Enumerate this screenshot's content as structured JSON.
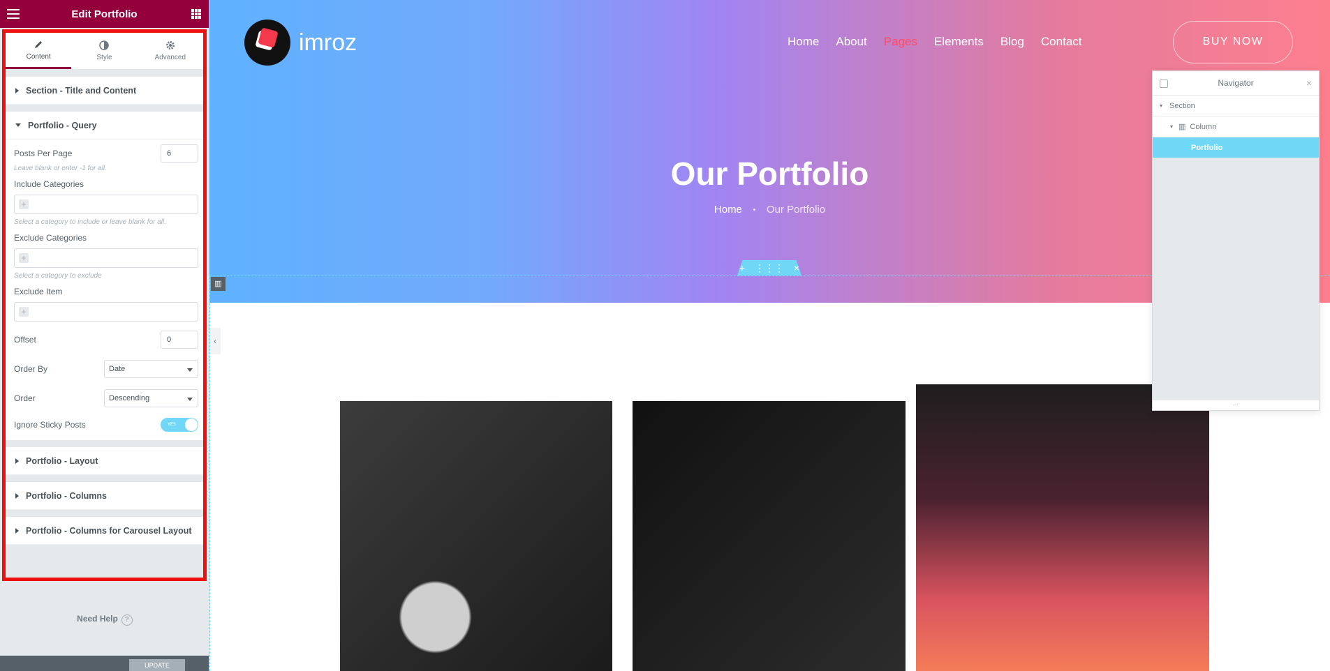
{
  "editor": {
    "title": "Edit Portfolio",
    "tabs": [
      "Content",
      "Style",
      "Advanced"
    ],
    "sections": {
      "title_content": "Section - Title and Content",
      "query": "Portfolio - Query",
      "layout": "Portfolio - Layout",
      "columns": "Portfolio - Columns",
      "carousel": "Portfolio - Columns for Carousel Layout"
    },
    "posts_per_page": {
      "label": "Posts Per Page",
      "value": "6",
      "desc": "Leave blank or enter -1 for all."
    },
    "include_categories": {
      "label": "Include Categories",
      "desc": "Select a category to include or leave blank for all."
    },
    "exclude_categories": {
      "label": "Exclude Categories",
      "desc": "Select a category to exclude"
    },
    "exclude_item": {
      "label": "Exclude Item"
    },
    "offset": {
      "label": "Offset",
      "value": "0"
    },
    "order_by": {
      "label": "Order By",
      "value": "Date"
    },
    "order": {
      "label": "Order",
      "value": "Descending"
    },
    "ignore_sticky": {
      "label": "Ignore Sticky Posts",
      "value": "YES"
    },
    "help": "Need Help",
    "help_icon": "?",
    "update": "UPDATE"
  },
  "site": {
    "logo_text": "imroz",
    "nav": [
      "Home",
      "About",
      "Pages",
      "Elements",
      "Blog",
      "Contact"
    ],
    "buy": "BUY NOW",
    "title": "Our Portfolio",
    "breadcrumb": [
      "Home",
      "Our Portfolio"
    ]
  },
  "navigator": {
    "title": "Navigator",
    "items": [
      "Section",
      "Column",
      "Portfolio"
    ]
  },
  "colors": {
    "editor_header": "#93003c",
    "highlight": "#ee0f0f",
    "accent": "#71d7f7",
    "active_nav": "#ff4b65"
  }
}
